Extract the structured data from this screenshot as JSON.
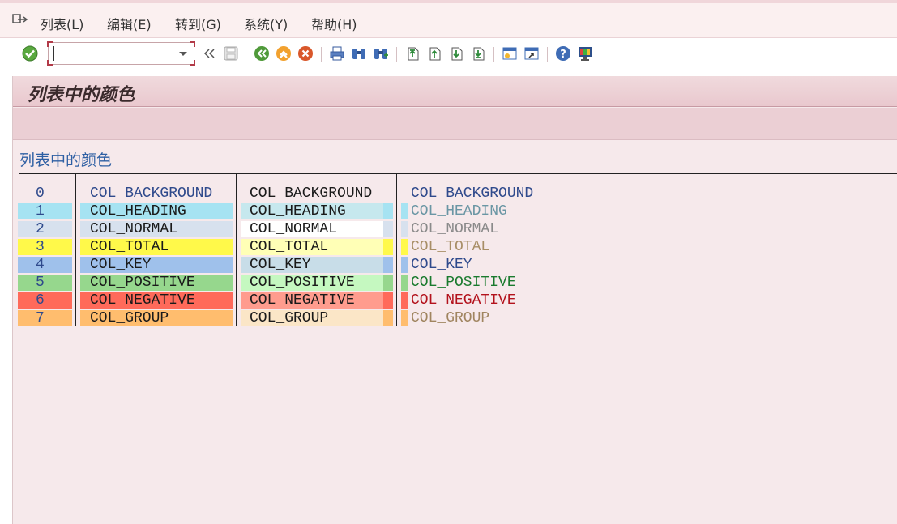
{
  "menu": {
    "items": [
      {
        "label": "列表(L)"
      },
      {
        "label": "编辑(E)"
      },
      {
        "label": "转到(G)"
      },
      {
        "label": "系统(Y)"
      },
      {
        "label": "帮助(H)"
      }
    ]
  },
  "toolbar": {
    "command_field_value": "",
    "icons": [
      "enter-icon",
      "command-field-dropdown-icon",
      "collapse-icon",
      "save-icon",
      "back-icon",
      "exit-icon",
      "cancel-icon",
      "print-icon",
      "find-icon",
      "find-next-icon",
      "first-page-icon",
      "previous-page-icon",
      "next-page-icon",
      "last-page-icon",
      "create-session-icon",
      "shortcut-icon",
      "help-icon",
      "customize-layout-icon"
    ]
  },
  "screen": {
    "title": "列表中的颜色",
    "list_heading": "列表中的颜色"
  },
  "table": {
    "numbers": [
      "0",
      "1",
      "2",
      "3",
      "4",
      "5",
      "6",
      "7"
    ],
    "names": [
      "COL_BACKGROUND",
      "COL_HEADING",
      "COL_NORMAL",
      "COL_TOTAL",
      "COL_KEY",
      "COL_POSITIVE",
      "COL_NEGATIVE",
      "COL_GROUP"
    ],
    "palette": {
      "intensified": [
        "#f6e9eb",
        "#a6e3f2",
        "#d7e1ee",
        "#fff94a",
        "#9fc1eb",
        "#96d78d",
        "#ff6a5a",
        "#ffbd6e"
      ],
      "normal": [
        "#f6e9eb",
        "#c6e8ee",
        "#ffffff",
        "#ffffb6",
        "#c8dde8",
        "#c5f8c0",
        "#ff9c8e",
        "#fbe6c7"
      ],
      "inverse_text": [
        "#2f4a8c",
        "#6a96a4",
        "#8a8a8a",
        "#a88e66",
        "#2f4a8c",
        "#1a7a2e",
        "#b3121c",
        "#a08560"
      ],
      "text": "#1a1a1a",
      "number_text": "#2f4a8c"
    }
  }
}
